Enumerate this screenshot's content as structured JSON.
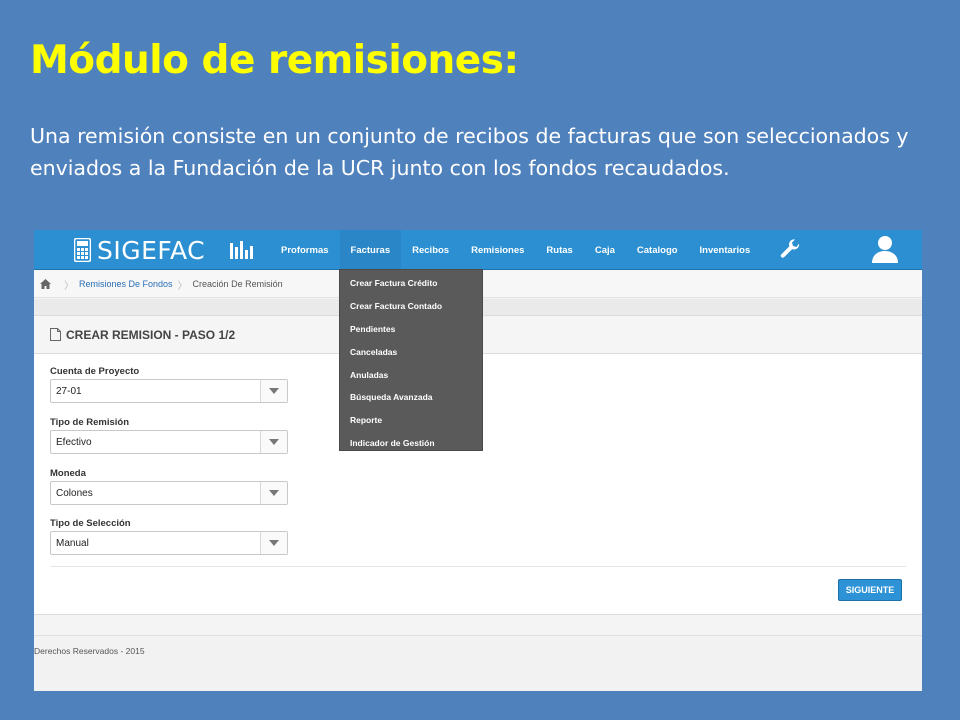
{
  "slide": {
    "title": "Módulo de remisiones:",
    "body": "Una remisión consiste en un conjunto de recibos de facturas que son seleccionados y enviados a la Fundación de la UCR junto con los fondos recaudados."
  },
  "app": {
    "logo": "SIGEFAC",
    "nav": [
      {
        "label": "Proformas"
      },
      {
        "label": "Facturas"
      },
      {
        "label": "Recibos"
      },
      {
        "label": "Remisiones"
      },
      {
        "label": "Rutas"
      },
      {
        "label": "Caja"
      },
      {
        "label": "Catalogo"
      },
      {
        "label": "Inventarios"
      }
    ],
    "breadcrumb": {
      "parent": "Remisiones De Fondos",
      "current": "Creación De Remisión"
    },
    "panel_title": "CREAR REMISION - PASO 1/2",
    "fields": [
      {
        "label": "Cuenta de Proyecto",
        "value": "27-01"
      },
      {
        "label": "Tipo de Remisión",
        "value": "Efectivo"
      },
      {
        "label": "Moneda",
        "value": "Colones"
      },
      {
        "label": "Tipo de Selección",
        "value": "Manual"
      }
    ],
    "next_button": "SIGUIENTE",
    "footer": "Derechos Reservados - 2015",
    "dropdown_menu": [
      {
        "label": "Crear Factura Crédito"
      },
      {
        "label": "Crear Factura Contado"
      },
      {
        "label": "Pendientes"
      },
      {
        "label": "Canceladas"
      },
      {
        "label": "Anuladas"
      },
      {
        "label": "Búsqueda Avanzada"
      },
      {
        "label": "Reporte"
      },
      {
        "label": "Indicador de Gestión"
      }
    ],
    "icons": {
      "logo": "calculator-icon",
      "charts": "bar-chart-icon",
      "settings": "wrench-icon",
      "user": "user-icon",
      "home": "home-icon",
      "doc": "document-icon"
    },
    "colors": {
      "slide_background": "#4f81bd",
      "title": "#ffff00",
      "topbar": "#2b8fd1",
      "menu": "#5a5a5a",
      "button": "#2d93d6"
    }
  }
}
